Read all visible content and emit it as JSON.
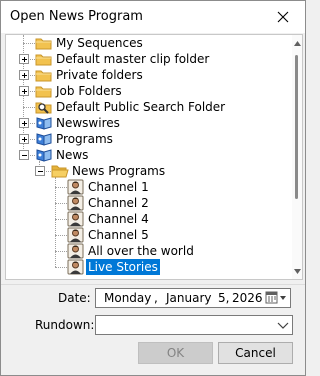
{
  "window": {
    "title": "Open News Program"
  },
  "tree": {
    "items": [
      {
        "label": "My Sequences",
        "icon": "folder-icon",
        "depth": 0,
        "expander": "none",
        "selected": false
      },
      {
        "label": "Default master clip folder",
        "icon": "folder-icon",
        "depth": 0,
        "expander": "plus",
        "selected": false
      },
      {
        "label": "Private folders",
        "icon": "folder-icon",
        "depth": 0,
        "expander": "plus",
        "selected": false
      },
      {
        "label": "Job Folders",
        "icon": "folder-icon",
        "depth": 0,
        "expander": "plus",
        "selected": false
      },
      {
        "label": "Default Public Search Folder",
        "icon": "search-folder-icon",
        "depth": 0,
        "expander": "none",
        "selected": false
      },
      {
        "label": "Newswires",
        "icon": "newswire-icon",
        "depth": 0,
        "expander": "plus",
        "selected": false
      },
      {
        "label": "Programs",
        "icon": "newswire-icon",
        "depth": 0,
        "expander": "plus",
        "selected": false
      },
      {
        "label": "News",
        "icon": "newswire-icon",
        "depth": 0,
        "expander": "minus",
        "selected": false
      },
      {
        "label": "News Programs",
        "icon": "folder-open-icon",
        "depth": 1,
        "expander": "minus",
        "selected": false
      },
      {
        "label": "Channel 1",
        "icon": "program-icon",
        "depth": 2,
        "expander": "none",
        "selected": false
      },
      {
        "label": "Channel 2",
        "icon": "program-icon",
        "depth": 2,
        "expander": "none",
        "selected": false
      },
      {
        "label": "Channel 4",
        "icon": "program-icon",
        "depth": 2,
        "expander": "none",
        "selected": false
      },
      {
        "label": "Channel 5",
        "icon": "program-icon",
        "depth": 2,
        "expander": "none",
        "selected": false
      },
      {
        "label": "All over the world",
        "icon": "program-icon",
        "depth": 2,
        "expander": "none",
        "selected": false
      },
      {
        "label": "Live Stories",
        "icon": "program-icon",
        "depth": 2,
        "expander": "none",
        "selected": true
      }
    ]
  },
  "form": {
    "date_label": "Date:",
    "date": {
      "weekday": "Monday",
      "sep1": ",",
      "month": "January",
      "day": "5,",
      "year": "2026"
    },
    "rundown_label": "Rundown:",
    "rundown_value": ""
  },
  "buttons": {
    "ok": "OK",
    "cancel": "Cancel"
  },
  "colors": {
    "selection": "#0078d7",
    "folder": "#f2c24f"
  }
}
